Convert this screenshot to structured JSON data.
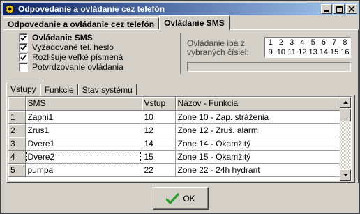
{
  "window": {
    "title": "Odpovedanie a ovládanie cez telefón",
    "title_icon": "sun-gear-icon",
    "controls": {
      "minimize": "_",
      "maximize": "□",
      "close": "×"
    }
  },
  "outer_tabs": [
    {
      "label": "Odpovedanie a ovládanie cez telefón",
      "active": false
    },
    {
      "label": "Ovládanie SMS",
      "active": true
    }
  ],
  "sms_options": [
    {
      "label": "Ovládanie SMS",
      "checked": true,
      "bold": true
    },
    {
      "label": "Vyžadované tel. heslo",
      "checked": true,
      "bold": false
    },
    {
      "label": "Rozlišuje veľké písmená",
      "checked": true,
      "bold": false
    },
    {
      "label": "Potvrdzovanie ovládania",
      "checked": false,
      "bold": false
    }
  ],
  "only_from_numbers": {
    "label": "Ovládanie iba z vybraných čísiel:",
    "numbers_row1": [
      "1",
      "2",
      "3",
      "4",
      "5",
      "6",
      "7",
      "8"
    ],
    "numbers_row2": [
      "9",
      "10",
      "11",
      "12",
      "13",
      "14",
      "15",
      "16"
    ],
    "field_value": ""
  },
  "inner_tabs": [
    {
      "label": "Vstupy",
      "active": true
    },
    {
      "label": "Funkcie",
      "active": false
    },
    {
      "label": "Stav systému",
      "active": false
    }
  ],
  "table": {
    "columns": [
      "",
      "SMS",
      "Vstup",
      "Názov - Funkcia"
    ],
    "rows": [
      {
        "n": "1",
        "sms": "Zapni1",
        "vstup": "10",
        "func": "Zone  10 - Zap. stráženia"
      },
      {
        "n": "2",
        "sms": "Zrus1",
        "vstup": "12",
        "func": "Zone  12 - Zruš. alarm"
      },
      {
        "n": "3",
        "sms": "Dvere1",
        "vstup": "14",
        "func": "Zone  14 - Okamžitý"
      },
      {
        "n": "4",
        "sms": "Dvere2",
        "vstup": "15",
        "func": "Zone  15 - Okamžitý"
      },
      {
        "n": "5",
        "sms": "pumpa",
        "vstup": "22",
        "func": "Zone  22 - 24h hydrant"
      }
    ]
  },
  "ok_button": {
    "label": "OK",
    "icon": "green-checkmark-icon"
  },
  "colors": {
    "titlebar_start": "#0a246a",
    "titlebar_end": "#a6caf0",
    "face": "#d4d0c8",
    "check_green": "#2a9d2a"
  }
}
